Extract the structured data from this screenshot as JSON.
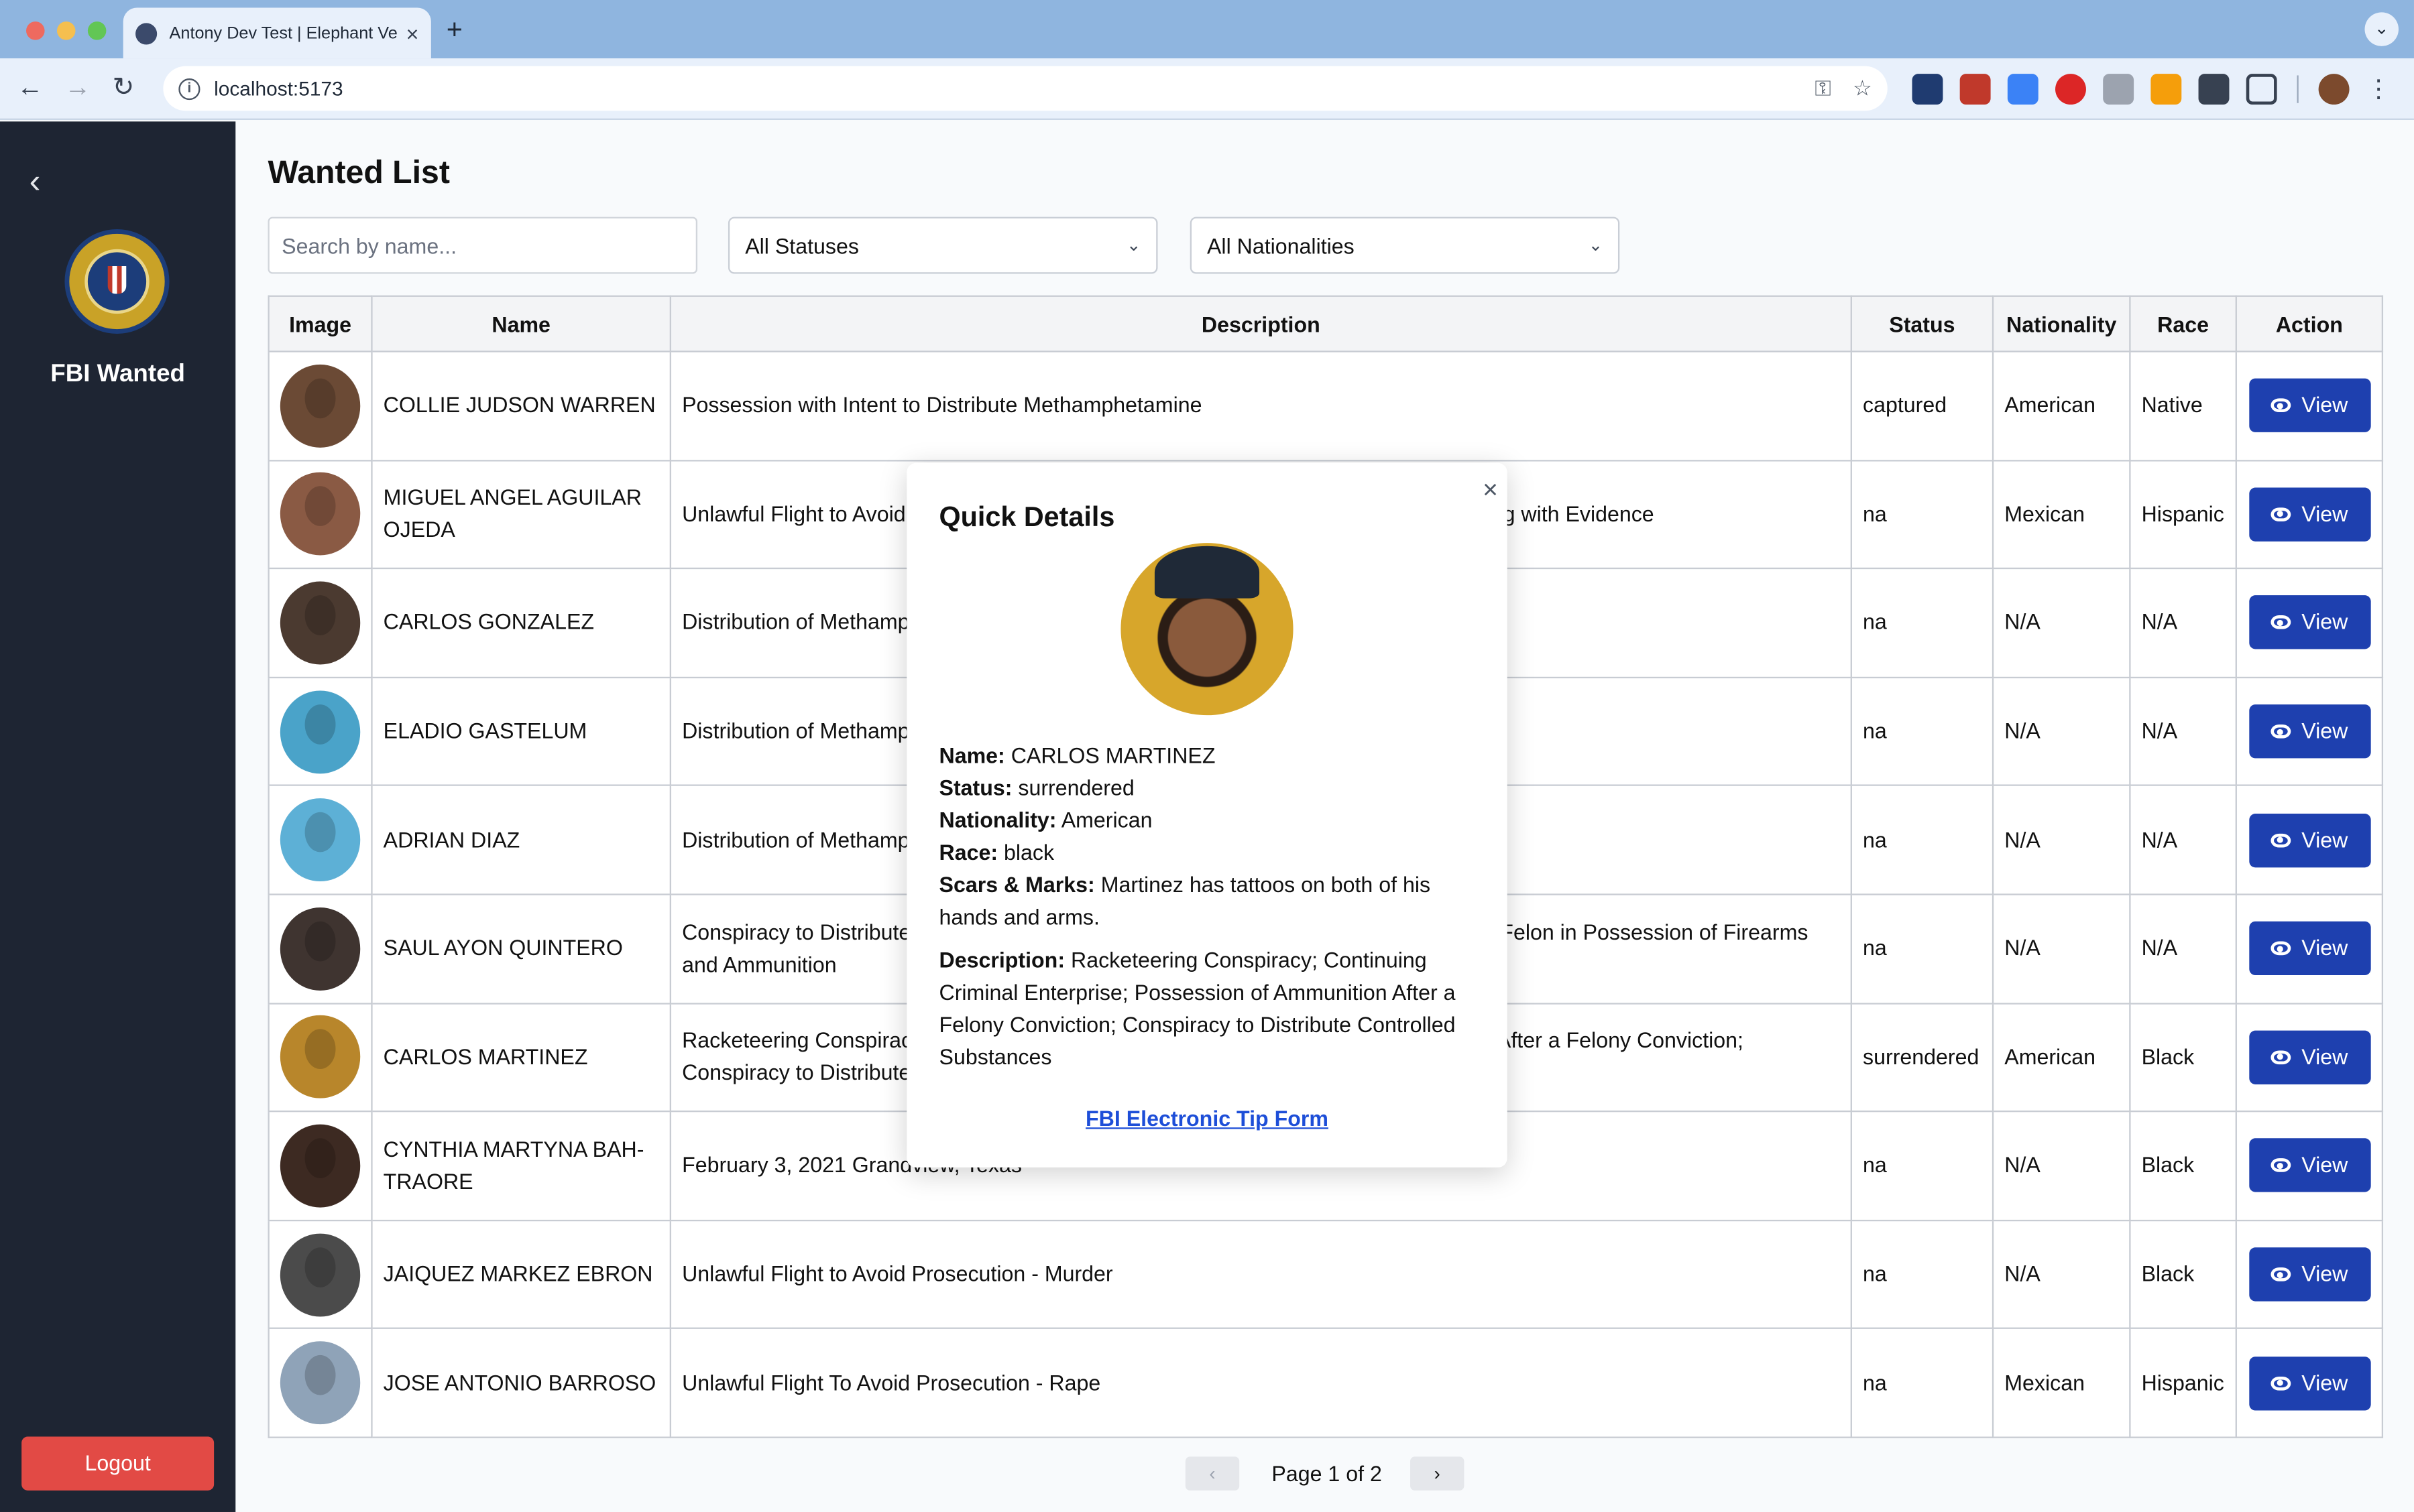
{
  "browser": {
    "tab_title": "Antony Dev Test | Elephant Ve",
    "tab_close": "×",
    "new_tab": "+",
    "tab_menu": "⌄",
    "url": "localhost:5173",
    "nav_back": "←",
    "nav_forward": "→",
    "nav_reload": "↻",
    "omni_key": "⚿",
    "omni_star": "☆",
    "kebab": "⋮"
  },
  "sidebar": {
    "back": "‹",
    "brand": "FBI Wanted",
    "logout": "Logout"
  },
  "main": {
    "title": "Wanted List",
    "search_placeholder": "Search by name...",
    "status_filter": "All Statuses",
    "nationality_filter": "All Nationalities",
    "chevron": "⌄"
  },
  "table": {
    "headers": {
      "image": "Image",
      "name": "Name",
      "description": "Description",
      "status": "Status",
      "nationality": "Nationality",
      "race": "Race",
      "action": "Action"
    },
    "view_label": "View",
    "rows": [
      {
        "name": "COLLIE JUDSON WARREN",
        "description": "Possession with Intent to Distribute Methamphetamine",
        "status": "captured",
        "nationality": "American",
        "race": "Native",
        "photo_color": "#6b4a35"
      },
      {
        "name": "MIGUEL ANGEL AGUILAR OJEDA",
        "description": "Unlawful Flight to Avoid Prosecution - Murder, Kidnapping, Abuse of Corpse, Tampering with Evidence",
        "status": "na",
        "nationality": "Mexican",
        "race": "Hispanic",
        "photo_color": "#8a5a44"
      },
      {
        "name": "CARLOS GONZALEZ",
        "description": "Distribution of Methamphetamine",
        "status": "na",
        "nationality": "N/A",
        "race": "N/A",
        "photo_color": "#4b3a30"
      },
      {
        "name": "ELADIO GASTELUM",
        "description": "Distribution of Methamphetamine",
        "status": "na",
        "nationality": "N/A",
        "race": "N/A",
        "photo_color": "#4aa3c9"
      },
      {
        "name": "ADRIAN DIAZ",
        "description": "Distribution of Methamphetamine",
        "status": "na",
        "nationality": "N/A",
        "race": "N/A",
        "photo_color": "#5db0d6"
      },
      {
        "name": "SAUL AYON QUINTERO",
        "description": "Conspiracy to Distribute and Possess with Intent to Distribute Controlled Substances; Felon in Possession of Firearms and Ammunition",
        "status": "na",
        "nationality": "N/A",
        "race": "N/A",
        "photo_color": "#3f3430"
      },
      {
        "name": "CARLOS MARTINEZ",
        "description": "Racketeering Conspiracy; Continuing Criminal Enterprise; Possession of Ammunition After a Felony Conviction; Conspiracy to Distribute Controlled Substances",
        "status": "surrendered",
        "nationality": "American",
        "race": "Black",
        "photo_color": "#b8862b"
      },
      {
        "name": "CYNTHIA MARTYNA BAH-TRAORE",
        "description": "February 3, 2021 Grandview, Texas",
        "status": "na",
        "nationality": "N/A",
        "race": "Black",
        "photo_color": "#3d2a22"
      },
      {
        "name": "JAIQUEZ MARKEZ EBRON",
        "description": "Unlawful Flight to Avoid Prosecution - Murder",
        "status": "na",
        "nationality": "N/A",
        "race": "Black",
        "photo_color": "#4b4b4b"
      },
      {
        "name": "JOSE ANTONIO BARROSO",
        "description": "Unlawful Flight To Avoid Prosecution - Rape",
        "status": "na",
        "nationality": "Mexican",
        "race": "Hispanic",
        "photo_color": "#8fa3b8"
      }
    ]
  },
  "pagination": {
    "prev": "‹",
    "label": "Page 1 of 2",
    "next": "›"
  },
  "modal": {
    "title": "Quick Details",
    "close": "×",
    "name_label": "Name:",
    "name_value": "CARLOS MARTINEZ",
    "status_label": "Status:",
    "status_value": "surrendered",
    "nationality_label": "Nationality:",
    "nationality_value": "American",
    "race_label": "Race:",
    "race_value": "black",
    "scars_label": "Scars & Marks:",
    "scars_value": "Martinez has tattoos on both of his hands and arms.",
    "description_label": "Description:",
    "description_value": "Racketeering Conspiracy; Continuing Criminal Enterprise; Possession of Ammunition After a Felony Conviction; Conspiracy to Distribute Controlled Substances",
    "tip_link": "FBI Electronic Tip Form"
  },
  "colors": {
    "sidebar_bg": "#1e2533",
    "view_button": "#1e40af",
    "logout_button": "#e24a45",
    "tip_link": "#1d4ed8"
  }
}
